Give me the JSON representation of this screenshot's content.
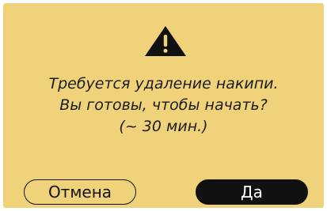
{
  "dialog": {
    "icon": "warning-triangle-icon",
    "message_lines": [
      "Требуется удаление накипи.",
      "Вы готовы, чтобы начать?",
      "(~ 30 мин.)"
    ],
    "cancel_label": "Отмена",
    "confirm_label": "Да"
  },
  "colors": {
    "background": "#f0d27a",
    "text": "#1c1c1c",
    "button_dark": "#111111",
    "button_text_light": "#ffffff"
  }
}
